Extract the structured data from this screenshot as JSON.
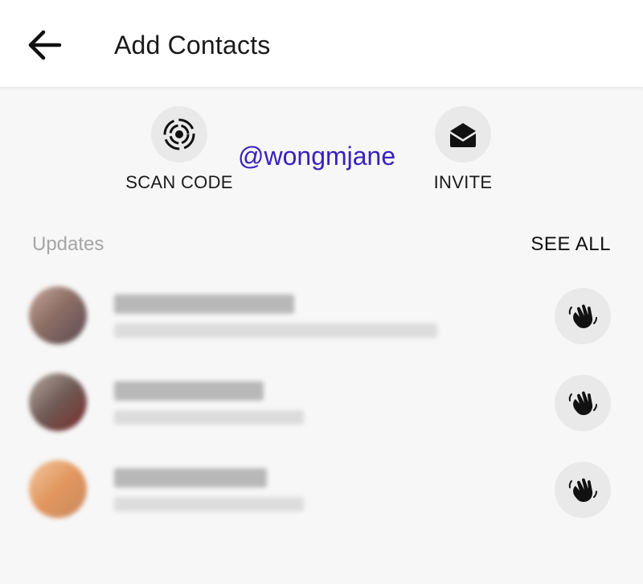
{
  "header": {
    "title": "Add Contacts",
    "back_icon": "arrow-left-icon"
  },
  "actions": [
    {
      "label": "SCAN CODE",
      "icon": "scan-code-icon"
    },
    {
      "label": "INVITE",
      "icon": "envelope-icon"
    }
  ],
  "handle": "@wongmjane",
  "updates": {
    "label": "Updates",
    "see_all": "SEE ALL",
    "contacts": [
      {
        "avatar_color": "#a3867d",
        "wave_icon": "wave-hand-icon"
      },
      {
        "avatar_color": "#7c6c66",
        "wave_icon": "wave-hand-icon"
      },
      {
        "avatar_color": "#e2a070",
        "wave_icon": "wave-hand-icon"
      }
    ]
  },
  "colors": {
    "handle": "#3a1fc0",
    "background": "#f7f7f7",
    "muted": "#a5a5a5"
  }
}
